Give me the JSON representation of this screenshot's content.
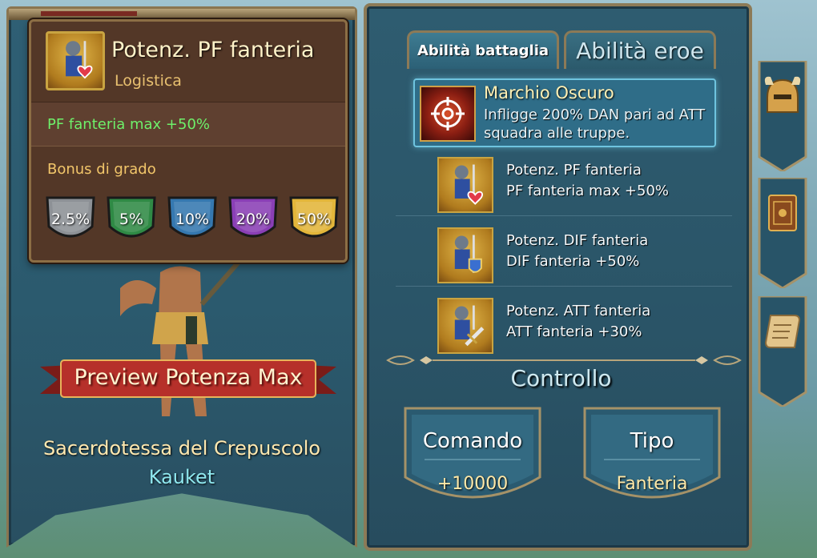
{
  "left_panel": {
    "skill": {
      "title": "Potenz. PF fanteria",
      "subtitle": "Logistica",
      "effect": "PF fanteria max +50%",
      "rank_label": "Bonus di grado",
      "ranks": [
        {
          "value": "2.5%",
          "color": "#8d9196"
        },
        {
          "value": "5%",
          "color": "#2f8a45"
        },
        {
          "value": "10%",
          "color": "#3578b0"
        },
        {
          "value": "20%",
          "color": "#8a3fb6"
        },
        {
          "value": "50%",
          "color": "#e3b63a"
        }
      ]
    },
    "preview_button": "Preview Potenza Max",
    "hero_title": "Sacerdotessa del Crepuscolo",
    "hero_name": "Kauket"
  },
  "right_panel": {
    "tabs": [
      {
        "label": "Abilità battaglia",
        "active": true
      },
      {
        "label": "Abilità eroe",
        "active": false
      }
    ],
    "main_skill": {
      "name": "Marchio Oscuro",
      "description": "Infligge 200% DAN pari ad ATT squadra alle truppe.",
      "icon": "crosshair-icon"
    },
    "sub_skills": [
      {
        "name": "Potenz. PF fanteria",
        "effect": "PF fanteria max +50%",
        "icon": "heart-badge-icon"
      },
      {
        "name": "Potenz. DIF fanteria",
        "effect": "DIF fanteria +50%",
        "icon": "shield-badge-icon"
      },
      {
        "name": "Potenz. ATT fanteria",
        "effect": "ATT fanteria +30%",
        "icon": "sword-badge-icon"
      }
    ],
    "control": {
      "title": "Controllo",
      "stats": [
        {
          "label": "Comando",
          "value": "+10000"
        },
        {
          "label": "Tipo",
          "value": "Fanteria"
        }
      ]
    }
  },
  "side_tabs": [
    {
      "icon": "helmet-icon"
    },
    {
      "icon": "book-icon"
    },
    {
      "icon": "scroll-icon"
    }
  ]
}
